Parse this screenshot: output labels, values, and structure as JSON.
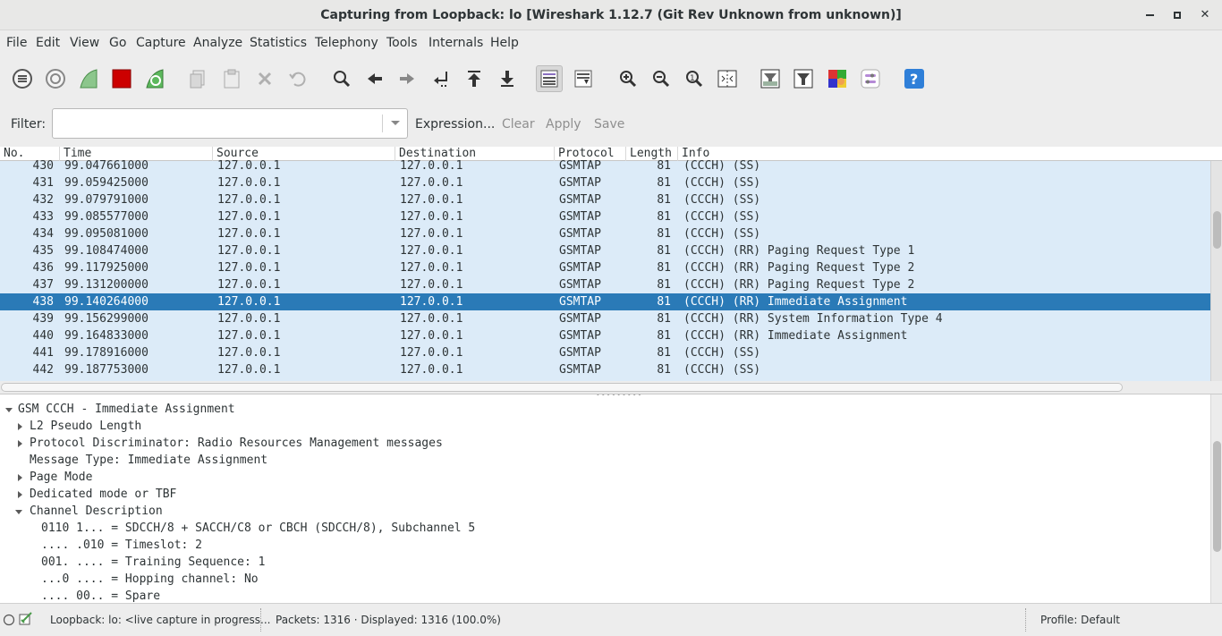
{
  "window": {
    "title": "Capturing from Loopback: lo    [Wireshark 1.12.7  (Git Rev Unknown from unknown)]",
    "minimize_glyph": "▬",
    "maximize_glyph": "■",
    "close_glyph": "✕"
  },
  "menu": [
    "File",
    "Edit",
    "View",
    "Go",
    "Capture",
    "Analyze",
    "Statistics",
    "Telephony",
    "Tools",
    "Internals",
    "Help"
  ],
  "toolbar": {
    "icons": [
      "interface-list-icon",
      "capture-options-icon",
      "start-capture-icon",
      "stop-capture-icon",
      "restart-capture-icon",
      "open-file-icon",
      "save-file-icon",
      "close-file-icon",
      "reload-icon",
      "find-packet-icon",
      "go-back-icon",
      "go-forward-icon",
      "go-to-packet-icon",
      "go-first-icon",
      "go-last-icon",
      "colorize-icon",
      "autoscroll-icon",
      "zoom-in-icon",
      "zoom-out-icon",
      "normal-size-icon",
      "resize-columns-icon",
      "capture-filters-icon",
      "display-filters-icon",
      "coloring-rules-icon",
      "preferences-icon",
      "help-icon"
    ],
    "accent_red": "#cc0000",
    "accent_green": "#4caf50",
    "help_blue": "#2f7fd8"
  },
  "filter": {
    "label": "Filter:",
    "value": "",
    "expression": "Expression...",
    "clear": "Clear",
    "apply": "Apply",
    "save": "Save"
  },
  "packet_list": {
    "columns": [
      "No.",
      "Time",
      "Source",
      "Destination",
      "Protocol",
      "Length",
      "Info"
    ],
    "rows": [
      {
        "no": "430",
        "time": "99.047661000",
        "src": "127.0.0.1",
        "dst": "127.0.0.1",
        "proto": "GSMTAP",
        "len": "81",
        "info": "(CCCH) (SS)"
      },
      {
        "no": "431",
        "time": "99.059425000",
        "src": "127.0.0.1",
        "dst": "127.0.0.1",
        "proto": "GSMTAP",
        "len": "81",
        "info": "(CCCH) (SS)"
      },
      {
        "no": "432",
        "time": "99.079791000",
        "src": "127.0.0.1",
        "dst": "127.0.0.1",
        "proto": "GSMTAP",
        "len": "81",
        "info": "(CCCH) (SS)"
      },
      {
        "no": "433",
        "time": "99.085577000",
        "src": "127.0.0.1",
        "dst": "127.0.0.1",
        "proto": "GSMTAP",
        "len": "81",
        "info": "(CCCH) (SS)"
      },
      {
        "no": "434",
        "time": "99.095081000",
        "src": "127.0.0.1",
        "dst": "127.0.0.1",
        "proto": "GSMTAP",
        "len": "81",
        "info": "(CCCH) (SS)"
      },
      {
        "no": "435",
        "time": "99.108474000",
        "src": "127.0.0.1",
        "dst": "127.0.0.1",
        "proto": "GSMTAP",
        "len": "81",
        "info": "(CCCH) (RR) Paging Request Type 1"
      },
      {
        "no": "436",
        "time": "99.117925000",
        "src": "127.0.0.1",
        "dst": "127.0.0.1",
        "proto": "GSMTAP",
        "len": "81",
        "info": "(CCCH) (RR) Paging Request Type 2"
      },
      {
        "no": "437",
        "time": "99.131200000",
        "src": "127.0.0.1",
        "dst": "127.0.0.1",
        "proto": "GSMTAP",
        "len": "81",
        "info": "(CCCH) (RR) Paging Request Type 2"
      },
      {
        "no": "438",
        "time": "99.140264000",
        "src": "127.0.0.1",
        "dst": "127.0.0.1",
        "proto": "GSMTAP",
        "len": "81",
        "info": "(CCCH) (RR) Immediate Assignment",
        "selected": true
      },
      {
        "no": "439",
        "time": "99.156299000",
        "src": "127.0.0.1",
        "dst": "127.0.0.1",
        "proto": "GSMTAP",
        "len": "81",
        "info": "(CCCH) (RR) System Information Type 4"
      },
      {
        "no": "440",
        "time": "99.164833000",
        "src": "127.0.0.1",
        "dst": "127.0.0.1",
        "proto": "GSMTAP",
        "len": "81",
        "info": "(CCCH) (RR) Immediate Assignment"
      },
      {
        "no": "441",
        "time": "99.178916000",
        "src": "127.0.0.1",
        "dst": "127.0.0.1",
        "proto": "GSMTAP",
        "len": "81",
        "info": "(CCCH) (SS)"
      },
      {
        "no": "442",
        "time": "99.187753000",
        "src": "127.0.0.1",
        "dst": "127.0.0.1",
        "proto": "GSMTAP",
        "len": "81",
        "info": "(CCCH) (SS)"
      }
    ],
    "row_bg": "#dcebf8",
    "selected_bg": "#2a7ab7"
  },
  "details": {
    "items": [
      {
        "text": "GSM CCCH - Immediate Assignment",
        "expander": "down"
      },
      {
        "text": "L2 Pseudo Length",
        "expander": "right"
      },
      {
        "text": "Protocol Discriminator: Radio Resources Management messages",
        "expander": "right"
      },
      {
        "text": "Message Type: Immediate Assignment",
        "expander": "none"
      },
      {
        "text": "Page Mode",
        "expander": "right"
      },
      {
        "text": "Dedicated mode or TBF",
        "expander": "right"
      },
      {
        "text": "Channel Description",
        "expander": "down"
      },
      {
        "text": "0110 1... = SDCCH/8 + SACCH/C8 or CBCH (SDCCH/8), Subchannel 5",
        "expander": "none"
      },
      {
        "text": ".... .010 = Timeslot: 2",
        "expander": "none"
      },
      {
        "text": "001. .... = Training Sequence: 1",
        "expander": "none"
      },
      {
        "text": "...0 .... = Hopping channel: No",
        "expander": "none"
      },
      {
        "text": ".... 00.. = Spare",
        "expander": "none"
      }
    ]
  },
  "status": {
    "interface": "Loopback: lo: <live capture in progress...",
    "packets": "Packets: 1316 · Displayed: 1316 (100.0%)",
    "profile": "Profile: Default"
  }
}
